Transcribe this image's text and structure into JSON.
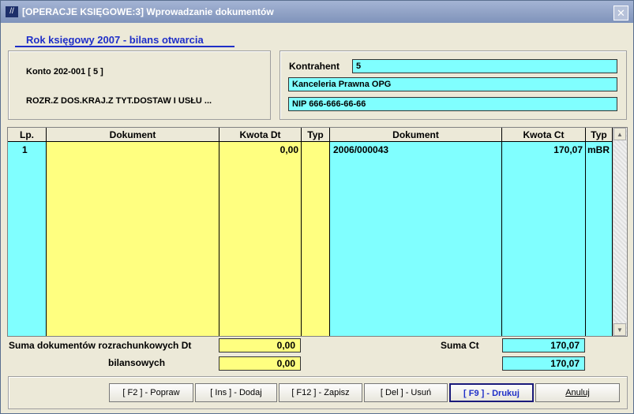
{
  "window": {
    "title": "[OPERACJE KSIĘGOWE:3]  Wprowadzanie dokumentów",
    "close_symbol": "✕"
  },
  "year_title": "Rok księgowy 2007   - bilans otwarcia",
  "konto": {
    "label": "Konto  202-001 [ 5 ]",
    "description": "ROZR.Z DOS.KRAJ.Z TYT.DOSTAW I USŁU ..."
  },
  "kontrahent": {
    "label": "Kontrahent",
    "id": "5",
    "name": "Kanceleria Prawna OPG",
    "nip": "NIP 666-666-66-66"
  },
  "table": {
    "headers": [
      "Lp.",
      "Dokument",
      "Kwota Dt",
      "Typ",
      "Dokument",
      "Kwota Ct",
      "Typ"
    ],
    "rows": [
      [
        "1",
        "",
        "0,00",
        "",
        "2006/000043",
        "170,07",
        "mBR"
      ]
    ]
  },
  "summary": {
    "dt_label": "Suma dokumentów rozrachunkowych Dt",
    "bil_label": "bilansowych",
    "ct_label": "Suma Ct",
    "dt_value": "0,00",
    "bil_value": "0,00",
    "ct_value": "170,07",
    "ct_bil_value": "170,07"
  },
  "buttons": {
    "popraw": "[ F2 ] - Popraw",
    "dodaj": "[ Ins ] - Dodaj",
    "zapisz": "[ F12 ] - Zapisz",
    "usun": "[ Del ] - Usuń",
    "drukuj": "[ F9 ] - Drukuj",
    "anuluj": "Anuluj"
  },
  "colors": {
    "cyan": "#80ffff",
    "yellow": "#ffff80",
    "link_blue": "#1f2fc8"
  }
}
